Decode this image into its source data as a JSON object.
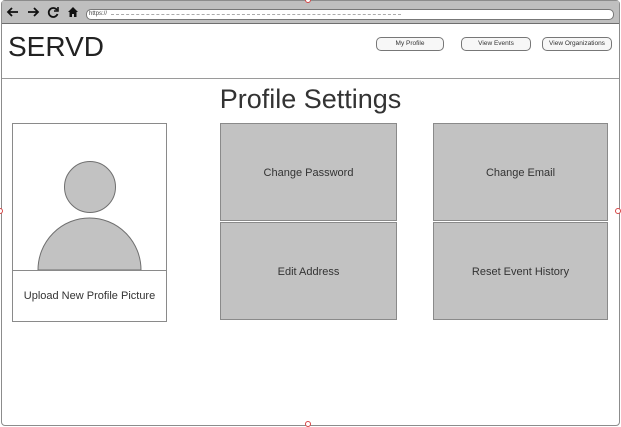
{
  "browser": {
    "url": "https://"
  },
  "header": {
    "brand": "SERVD",
    "nav": [
      {
        "label": "My  Profile"
      },
      {
        "label": "View Events"
      },
      {
        "label": "View Organizations"
      }
    ]
  },
  "page": {
    "title": "Profile Settings"
  },
  "profile_card": {
    "upload_label": "Upload New Profile Picture"
  },
  "actions": [
    {
      "label": "Change Password"
    },
    {
      "label": "Change Email"
    },
    {
      "label": "Edit Address"
    },
    {
      "label": "Reset Event History"
    }
  ],
  "colors": {
    "tile_fill": "#c2c2c2",
    "browser_bar": "#bfbfbf",
    "selection_handle": "#d64545"
  }
}
